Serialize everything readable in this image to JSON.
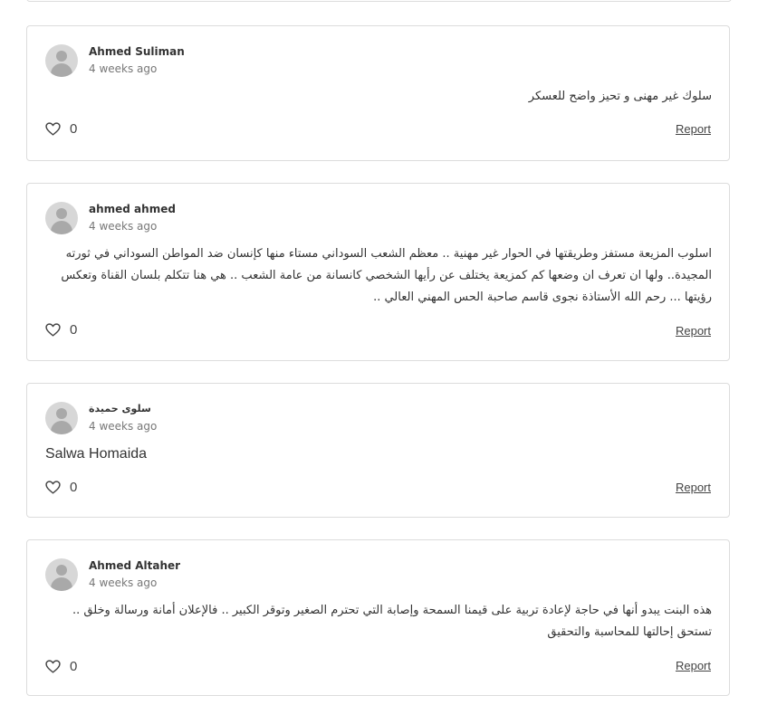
{
  "comments": [
    {
      "author": "Ahmed Suliman",
      "time": "4 weeks ago",
      "text": "سلوك غير مهنى و تحيز واضح للعسكر",
      "likes": "0",
      "report_label": "Report"
    },
    {
      "author": "ahmed ahmed",
      "time": "4 weeks ago",
      "text": "اسلوب المزيعة مستفز وطريقتها في الحوار غير مهنية .. معظم الشعب السوداني مستاء منها كإنسان ضد المواطن السوداني في ثورته المجيدة.. ولها ان تعرف ان وضعها كم كمزيعة يختلف عن رأيها الشخصي كانسانة من عامة الشعب .. هي هنا تتكلم بلسان القناة وتعكس رؤيتها ... رحم الله الأستاذة نجوى قاسم صاحبة الحس المهني العالي ..",
      "likes": "0",
      "report_label": "Report"
    },
    {
      "author": "سلوى حميدة",
      "time": "4 weeks ago",
      "text": "Salwa Homaida",
      "likes": "0",
      "report_label": "Report"
    },
    {
      "author": "Ahmed Altaher",
      "time": "4 weeks ago",
      "text": "هذه البنت يبدو أنها في حاجة لإعادة تربية على قيمنا السمحة وإصابة التي تحترم الصغير وتوقر الكبير .. فالإعلان أمانة ورسالة وخلق .. تستحق إحالتها للمحاسبة والتحقيق",
      "likes": "0",
      "report_label": "Report"
    }
  ]
}
